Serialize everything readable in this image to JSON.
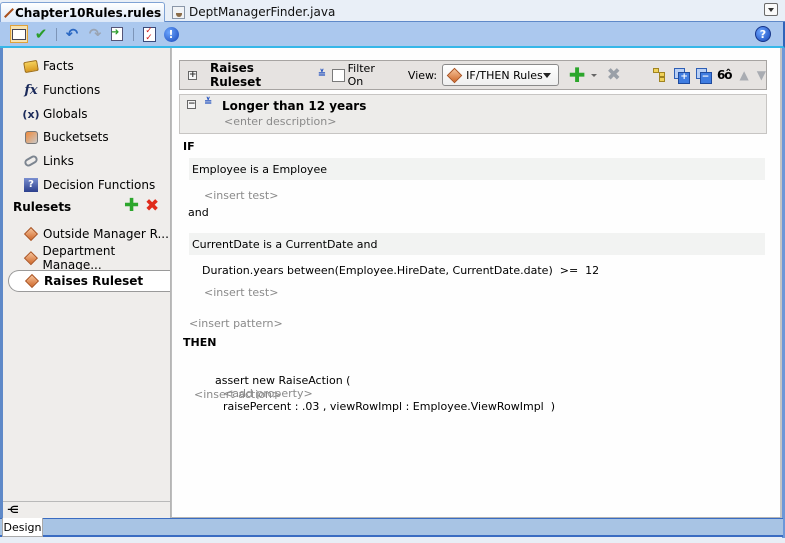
{
  "tabs": [
    {
      "label": "Chapter10Rules.rules",
      "icon": "ruleset-diamond-icon",
      "active": true
    },
    {
      "label": "DeptManagerFinder.java",
      "icon": "java-file-icon",
      "active": false
    }
  ],
  "toolbar": {
    "buttons": [
      {
        "name": "dictionary-view",
        "icon": "book-icon",
        "selected": true
      },
      {
        "name": "validate",
        "icon": "checkmark-icon"
      },
      {
        "name": "undo",
        "icon": "undo-icon"
      },
      {
        "name": "redo",
        "icon": "redo-icon",
        "disabled": true
      },
      {
        "name": "generate",
        "icon": "document-arrow-icon"
      },
      {
        "name": "test",
        "icon": "checklist-icon"
      },
      {
        "name": "info",
        "icon": "info-icon"
      }
    ],
    "help_icon": "help-icon"
  },
  "sidebar": {
    "items": [
      {
        "label": "Facts",
        "icon": "facts-icon"
      },
      {
        "label": "Functions",
        "icon": "fx-icon"
      },
      {
        "label": "Globals",
        "icon": "variable-icon",
        "glyph": "(x)"
      },
      {
        "label": "Bucketsets",
        "icon": "bucketset-icon"
      },
      {
        "label": "Links",
        "icon": "link-icon"
      },
      {
        "label": "Decision Functions",
        "icon": "decision-function-icon",
        "glyph": "?"
      }
    ],
    "rulesets_header": "Rulesets",
    "add_symbol": "✚",
    "delete_symbol": "✖",
    "rulesets": [
      {
        "label": "Outside Manager R...",
        "selected": false
      },
      {
        "label": "Department Manage...",
        "selected": false
      },
      {
        "label": "Raises Ruleset",
        "selected": true
      }
    ]
  },
  "editor": {
    "ruleset_title": "Raises Ruleset",
    "expand_symbol": "+",
    "collapse_symbol": "−",
    "chevron_symbol": "≚",
    "filter_label": "Filter On",
    "filter_checked": false,
    "view_label": "View:",
    "view_selected": "IF/THEN Rules",
    "add_rule_symbol": "✚",
    "delete_rule_symbol": "✖",
    "glasses_symbol": "6ô",
    "up_symbol": "▲",
    "down_symbol": "▼",
    "rule": {
      "title": "Longer than 12 years",
      "description_placeholder": "<enter description>",
      "if_label": "IF",
      "patterns": [
        {
          "text": "Employee is a Employee",
          "tests": [],
          "insert_test": "<insert test>"
        },
        {
          "text": "CurrentDate is a CurrentDate  and",
          "tests": [
            "Duration.years between(Employee.HireDate, CurrentDate.date)  >=  12"
          ],
          "insert_test": "<insert test>"
        }
      ],
      "and_label": "and",
      "insert_pattern": "<insert pattern>",
      "then_label": "THEN",
      "action": {
        "prefix": "assert new RaiseAction (",
        "add_property": "<add property>",
        "args": "raisePercent : .03 , viewRowImpl : Employee.ViewRowImpl  )"
      },
      "insert_action": "<insert action>"
    }
  },
  "bottom": {
    "collapse_glyph": "⋲",
    "tabs": [
      {
        "label": "Design",
        "active": true
      }
    ]
  }
}
